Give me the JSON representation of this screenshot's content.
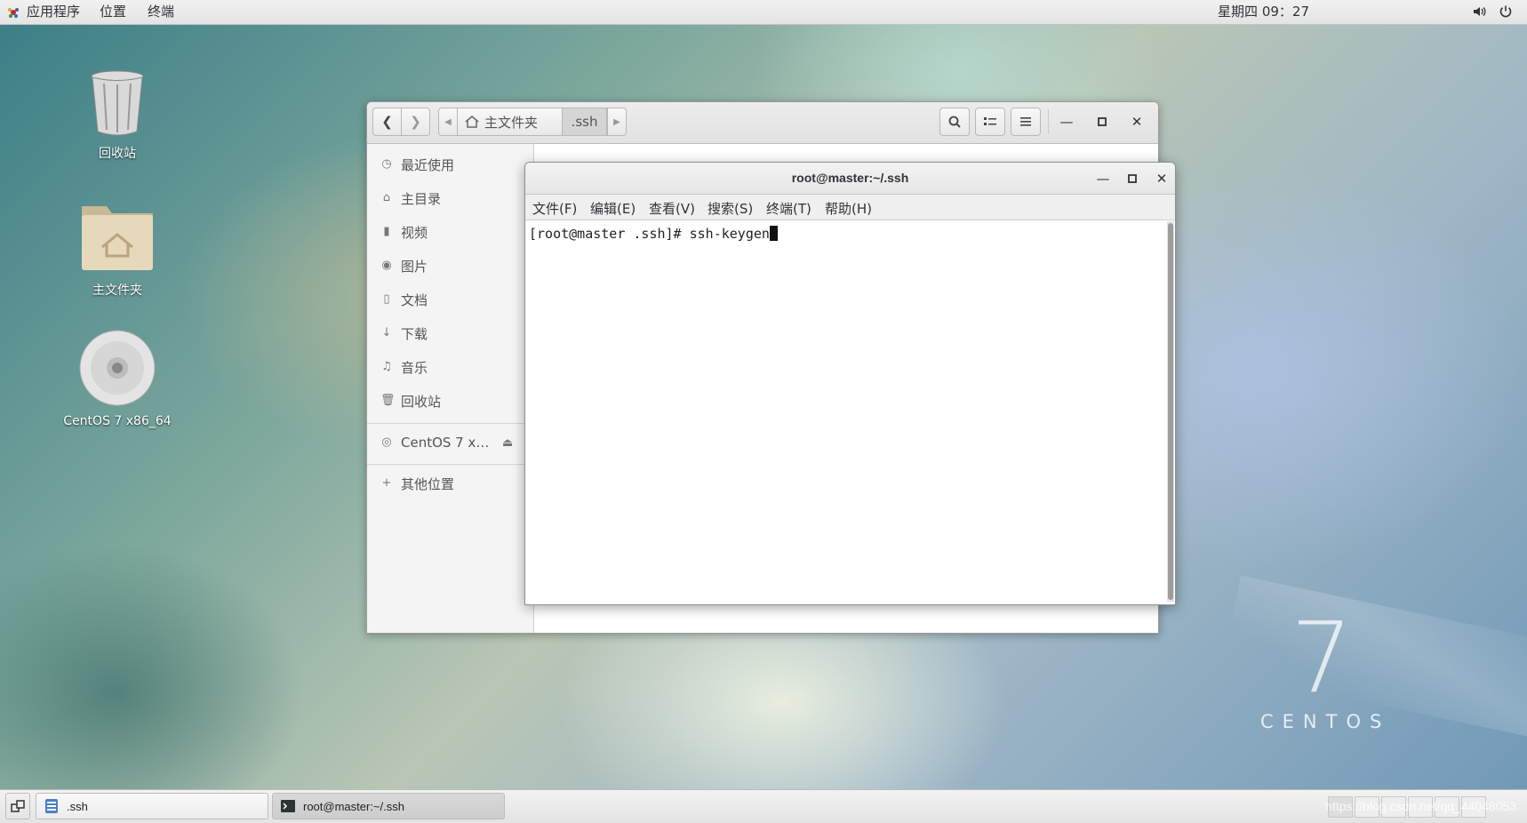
{
  "topbar": {
    "apps_label": "应用程序",
    "places_label": "位置",
    "terminal_label": "终端",
    "clock": "星期四 09：27"
  },
  "desktop": {
    "trash_label": "回收站",
    "home_label": "主文件夹",
    "disc_label": "CentOS 7 x86_64",
    "logo_number": "7",
    "logo_text": "CENTOS"
  },
  "file_manager": {
    "path": {
      "home": "主文件夹",
      "current": ".ssh"
    },
    "sidebar": {
      "items": [
        {
          "label": "最近使用",
          "icon": "clock-icon"
        },
        {
          "label": "主目录",
          "icon": "home-icon"
        },
        {
          "label": "视频",
          "icon": "video-icon"
        },
        {
          "label": "图片",
          "icon": "camera-icon"
        },
        {
          "label": "文档",
          "icon": "document-icon"
        },
        {
          "label": "下载",
          "icon": "download-icon"
        },
        {
          "label": "音乐",
          "icon": "music-icon"
        },
        {
          "label": "回收站",
          "icon": "trash-icon"
        }
      ],
      "device": "CentOS 7 x…",
      "other": "其他位置"
    }
  },
  "terminal": {
    "title": "root@master:~/.ssh",
    "menu": [
      "文件(F)",
      "编辑(E)",
      "查看(V)",
      "搜索(S)",
      "终端(T)",
      "帮助(H)"
    ],
    "line": "[root@master .ssh]# ssh-keygen"
  },
  "taskbar": {
    "items": [
      {
        "label": ".ssh",
        "icon": "file-manager-icon"
      },
      {
        "label": "root@master:~/.ssh",
        "icon": "terminal-icon"
      }
    ],
    "watermark": "https://blog.csdn.net/qq_44048053"
  },
  "colors": {
    "panel": "#e4e4e4",
    "accent": "#4a90d9",
    "sidebar": "#f4f4f4"
  }
}
